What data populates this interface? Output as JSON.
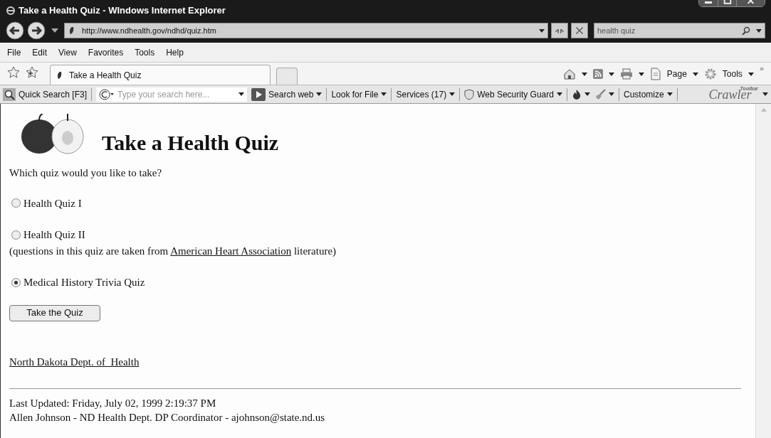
{
  "window": {
    "title": "Take a Health Quiz - WIndows Internet Explorer"
  },
  "address_bar": {
    "url": "http://www.ndhealth.gov/ndhd/quiz.htm"
  },
  "search_box": {
    "value": "health quiz"
  },
  "menu": [
    "File",
    "Edit",
    "View",
    "Favorites",
    "Tools",
    "Help"
  ],
  "tabs": [
    {
      "label": "Take a Health Quiz",
      "selected": true
    }
  ],
  "command_bar": [
    {
      "kind": "home"
    },
    {
      "kind": "feed"
    },
    {
      "kind": "print"
    },
    {
      "kind": "page",
      "label": "Page"
    },
    {
      "kind": "tools",
      "label": "Tools"
    }
  ],
  "command_bar_more": "»",
  "toolbar": {
    "quick_search": "Quick Search [F3]",
    "search_placeholder": "Type your search here...",
    "items": [
      {
        "label": "Search web",
        "kind": "play"
      },
      {
        "label": "Look for File",
        "kind": "text"
      },
      {
        "label": "Services (17)",
        "kind": "text"
      },
      {
        "label": "Web Security Guard",
        "kind": "shield"
      },
      {
        "kind": "fire"
      },
      {
        "kind": "broom"
      },
      {
        "label": "Customize",
        "kind": "text"
      }
    ],
    "logo": {
      "name": "Crawler",
      "tag": "Toolbar"
    }
  },
  "page": {
    "heading": "Take a Health Quiz",
    "question": "Which quiz would you like to take?",
    "options": [
      {
        "label": "Health Quiz I",
        "selected": false
      },
      {
        "label": "Health Quiz II",
        "selected": false,
        "note": "(questions in this quiz are taken from ",
        "note_link": "American Heart Association",
        "note_end": " literature)"
      },
      {
        "label": "Medical History Trivia Quiz",
        "selected": true
      }
    ],
    "submit": "Take the Quiz",
    "link": "North Dakota Dept. of  Health",
    "footer": [
      "Last Updated: Friday, July 02, 1999 2:19:37 PM",
      "Allen Johnson - ND Health Dept. DP Coordinator - ajohnson@state.nd.us"
    ]
  }
}
